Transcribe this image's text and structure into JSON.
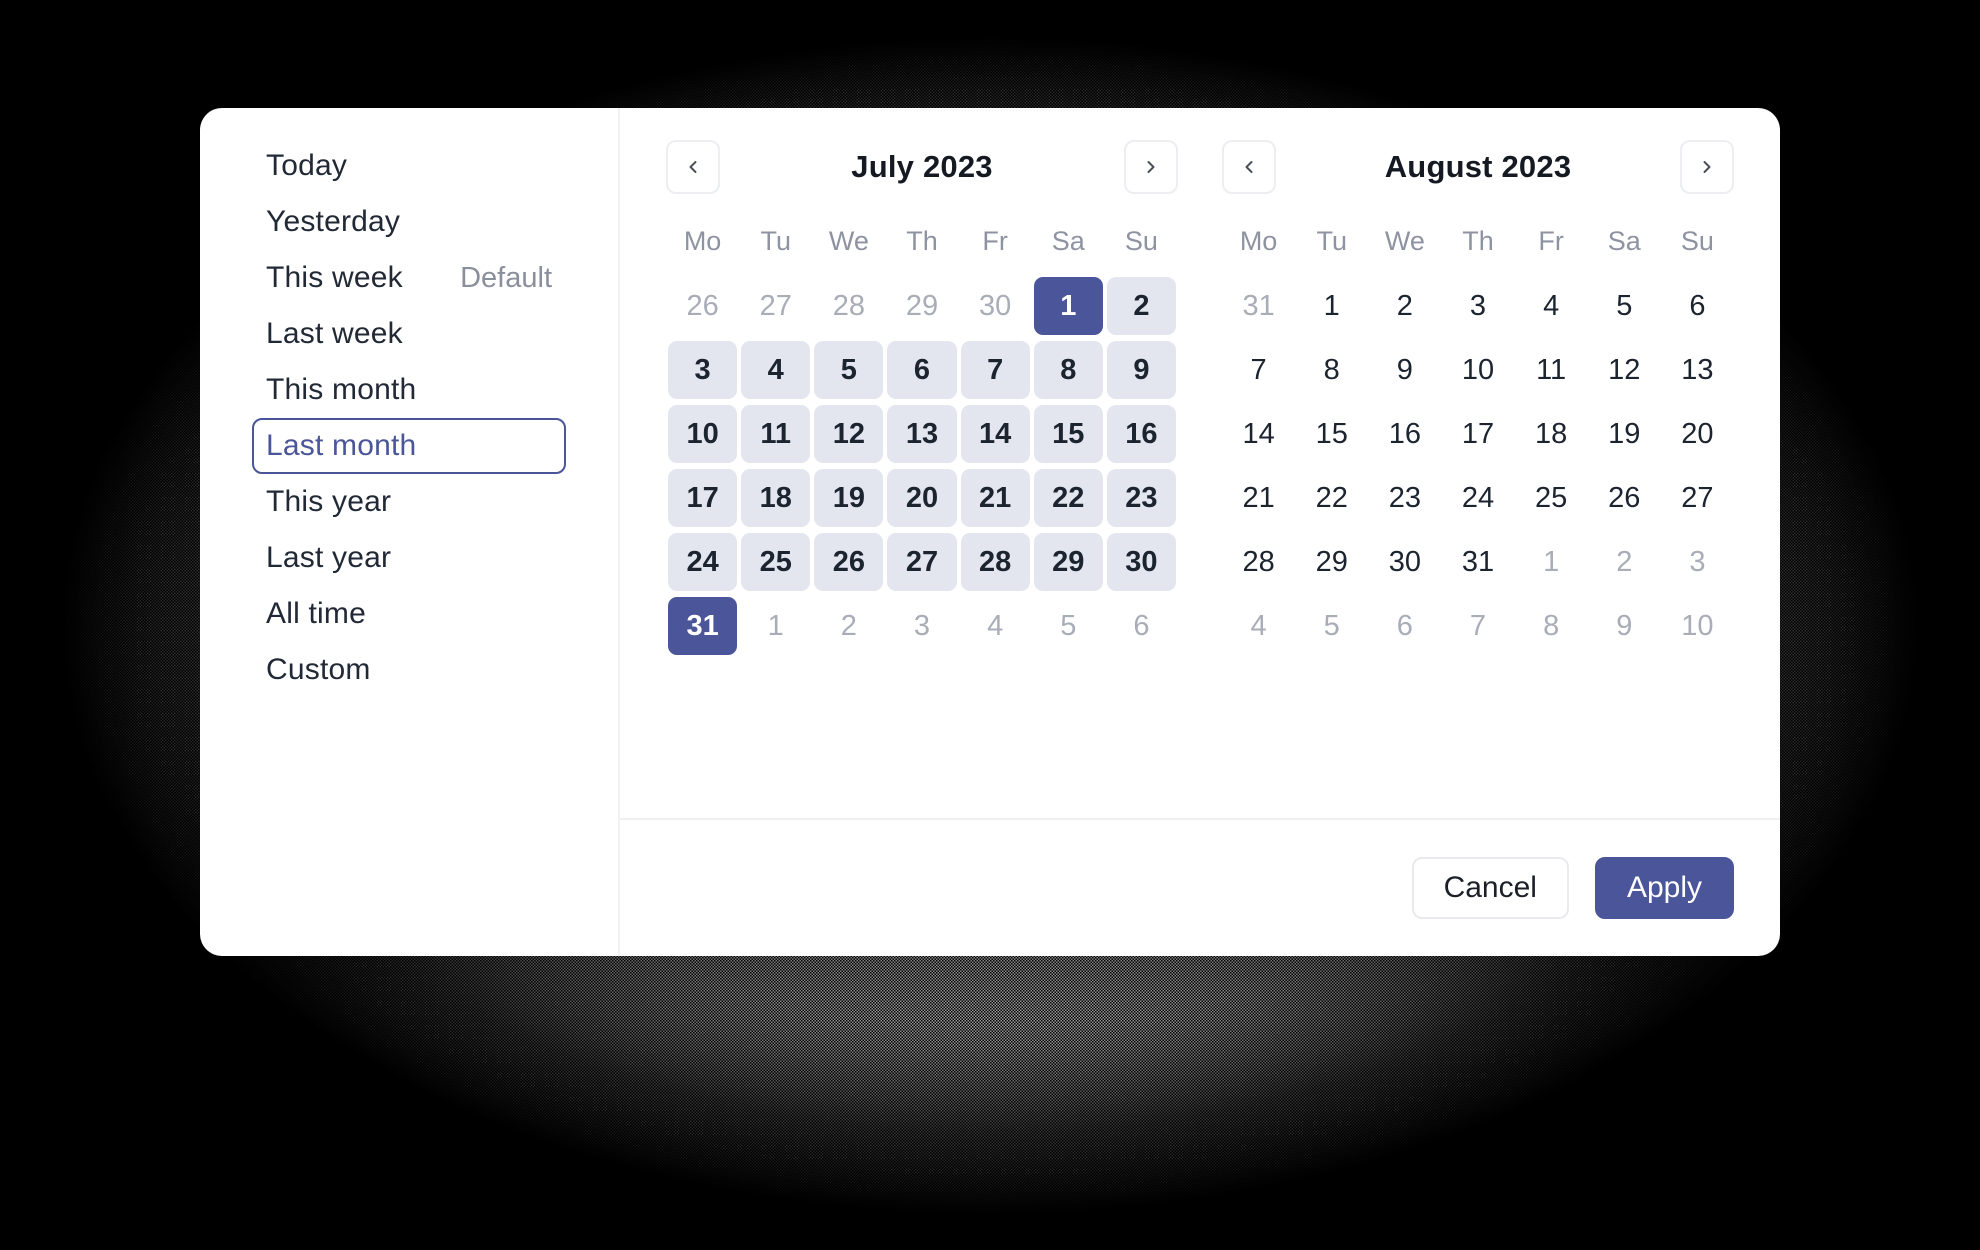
{
  "sidebar": {
    "items": [
      {
        "label": "Today",
        "badge": "",
        "selected": false
      },
      {
        "label": "Yesterday",
        "badge": "",
        "selected": false
      },
      {
        "label": "This week",
        "badge": "Default",
        "selected": false
      },
      {
        "label": "Last week",
        "badge": "",
        "selected": false
      },
      {
        "label": "This month",
        "badge": "",
        "selected": false
      },
      {
        "label": "Last month",
        "badge": "",
        "selected": true
      },
      {
        "label": "This year",
        "badge": "",
        "selected": false
      },
      {
        "label": "Last year",
        "badge": "",
        "selected": false
      },
      {
        "label": "All time",
        "badge": "",
        "selected": false
      },
      {
        "label": "Custom",
        "badge": "",
        "selected": false
      }
    ]
  },
  "calendars": [
    {
      "title": "July 2023",
      "prev_icon": "chevron-left-icon",
      "next_icon": "chevron-right-icon",
      "weekdays": [
        "Mo",
        "Tu",
        "We",
        "Th",
        "Fr",
        "Sa",
        "Su"
      ],
      "weeks": [
        [
          {
            "day": "26",
            "state": "outside"
          },
          {
            "day": "27",
            "state": "outside"
          },
          {
            "day": "28",
            "state": "outside"
          },
          {
            "day": "29",
            "state": "outside"
          },
          {
            "day": "30",
            "state": "outside"
          },
          {
            "day": "1",
            "state": "range-start"
          },
          {
            "day": "2",
            "state": "in-range"
          }
        ],
        [
          {
            "day": "3",
            "state": "in-range"
          },
          {
            "day": "4",
            "state": "in-range"
          },
          {
            "day": "5",
            "state": "in-range"
          },
          {
            "day": "6",
            "state": "in-range"
          },
          {
            "day": "7",
            "state": "in-range"
          },
          {
            "day": "8",
            "state": "in-range"
          },
          {
            "day": "9",
            "state": "in-range"
          }
        ],
        [
          {
            "day": "10",
            "state": "in-range"
          },
          {
            "day": "11",
            "state": "in-range"
          },
          {
            "day": "12",
            "state": "in-range"
          },
          {
            "day": "13",
            "state": "in-range"
          },
          {
            "day": "14",
            "state": "in-range"
          },
          {
            "day": "15",
            "state": "in-range"
          },
          {
            "day": "16",
            "state": "in-range"
          }
        ],
        [
          {
            "day": "17",
            "state": "in-range"
          },
          {
            "day": "18",
            "state": "in-range"
          },
          {
            "day": "19",
            "state": "in-range"
          },
          {
            "day": "20",
            "state": "in-range"
          },
          {
            "day": "21",
            "state": "in-range"
          },
          {
            "day": "22",
            "state": "in-range"
          },
          {
            "day": "23",
            "state": "in-range"
          }
        ],
        [
          {
            "day": "24",
            "state": "in-range"
          },
          {
            "day": "25",
            "state": "in-range"
          },
          {
            "day": "26",
            "state": "in-range"
          },
          {
            "day": "27",
            "state": "in-range"
          },
          {
            "day": "28",
            "state": "in-range"
          },
          {
            "day": "29",
            "state": "in-range"
          },
          {
            "day": "30",
            "state": "in-range"
          }
        ],
        [
          {
            "day": "31",
            "state": "range-end"
          },
          {
            "day": "1",
            "state": "outside"
          },
          {
            "day": "2",
            "state": "outside"
          },
          {
            "day": "3",
            "state": "outside"
          },
          {
            "day": "4",
            "state": "outside"
          },
          {
            "day": "5",
            "state": "outside"
          },
          {
            "day": "6",
            "state": "outside"
          }
        ]
      ]
    },
    {
      "title": "August 2023",
      "prev_icon": "chevron-left-icon",
      "next_icon": "chevron-right-icon",
      "weekdays": [
        "Mo",
        "Tu",
        "We",
        "Th",
        "Fr",
        "Sa",
        "Su"
      ],
      "weeks": [
        [
          {
            "day": "31",
            "state": "outside"
          },
          {
            "day": "1",
            "state": "normal"
          },
          {
            "day": "2",
            "state": "normal"
          },
          {
            "day": "3",
            "state": "normal"
          },
          {
            "day": "4",
            "state": "normal"
          },
          {
            "day": "5",
            "state": "normal"
          },
          {
            "day": "6",
            "state": "normal"
          }
        ],
        [
          {
            "day": "7",
            "state": "normal"
          },
          {
            "day": "8",
            "state": "normal"
          },
          {
            "day": "9",
            "state": "normal"
          },
          {
            "day": "10",
            "state": "normal"
          },
          {
            "day": "11",
            "state": "normal"
          },
          {
            "day": "12",
            "state": "normal"
          },
          {
            "day": "13",
            "state": "normal"
          }
        ],
        [
          {
            "day": "14",
            "state": "normal"
          },
          {
            "day": "15",
            "state": "normal"
          },
          {
            "day": "16",
            "state": "normal"
          },
          {
            "day": "17",
            "state": "normal"
          },
          {
            "day": "18",
            "state": "normal"
          },
          {
            "day": "19",
            "state": "normal"
          },
          {
            "day": "20",
            "state": "normal"
          }
        ],
        [
          {
            "day": "21",
            "state": "normal"
          },
          {
            "day": "22",
            "state": "normal"
          },
          {
            "day": "23",
            "state": "normal"
          },
          {
            "day": "24",
            "state": "normal"
          },
          {
            "day": "25",
            "state": "normal"
          },
          {
            "day": "26",
            "state": "normal"
          },
          {
            "day": "27",
            "state": "normal"
          }
        ],
        [
          {
            "day": "28",
            "state": "normal"
          },
          {
            "day": "29",
            "state": "normal"
          },
          {
            "day": "30",
            "state": "normal"
          },
          {
            "day": "31",
            "state": "normal"
          },
          {
            "day": "1",
            "state": "outside"
          },
          {
            "day": "2",
            "state": "outside"
          },
          {
            "day": "3",
            "state": "outside"
          }
        ],
        [
          {
            "day": "4",
            "state": "outside"
          },
          {
            "day": "5",
            "state": "outside"
          },
          {
            "day": "6",
            "state": "outside"
          },
          {
            "day": "7",
            "state": "outside"
          },
          {
            "day": "8",
            "state": "outside"
          },
          {
            "day": "9",
            "state": "outside"
          },
          {
            "day": "10",
            "state": "outside"
          }
        ]
      ]
    }
  ],
  "footer": {
    "cancel_label": "Cancel",
    "apply_label": "Apply"
  },
  "colors": {
    "accent": "#4a5699",
    "in_range": "#e4e6ef",
    "text": "#1c2430",
    "muted_text": "#a9adb8",
    "weekday_text": "#8e93a1",
    "divider": "#f0f0f4"
  }
}
